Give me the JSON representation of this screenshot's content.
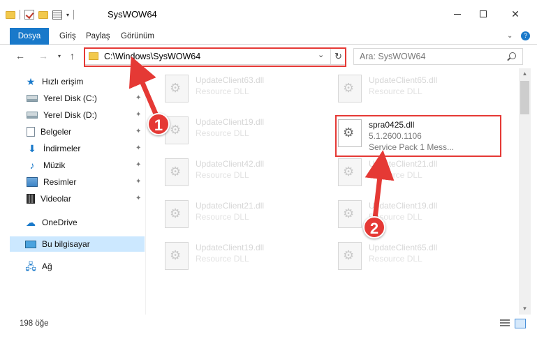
{
  "window": {
    "title": "SysWOW64",
    "minimize_glyph": "",
    "maximize_glyph": "",
    "close_glyph": "✕"
  },
  "ribbon": {
    "tabs": [
      {
        "label": "Dosya"
      },
      {
        "label": "Giriş"
      },
      {
        "label": "Paylaş"
      },
      {
        "label": "Görünüm"
      }
    ],
    "expand_glyph": "⌄",
    "help_glyph": "?"
  },
  "navigation": {
    "back_glyph": "←",
    "forward_glyph": "→",
    "recent_glyph": "▾",
    "up_glyph": "↑",
    "address": "C:\\Windows\\SysWOW64",
    "address_dropdown_glyph": "⌄",
    "refresh_glyph": "↻",
    "search_placeholder": "Ara: SysWOW64"
  },
  "sidebar": {
    "items": [
      {
        "label": "Hızlı erişim",
        "icon": "star-icon"
      },
      {
        "label": "Yerel Disk (C:)",
        "icon": "drive-icon",
        "pinned": true
      },
      {
        "label": "Yerel Disk (D:)",
        "icon": "drive-icon",
        "pinned": true
      },
      {
        "label": "Belgeler",
        "icon": "documents-icon",
        "pinned": true
      },
      {
        "label": "İndirmeler",
        "icon": "download-icon",
        "pinned": true
      },
      {
        "label": "Müzik",
        "icon": "music-icon",
        "pinned": true
      },
      {
        "label": "Resimler",
        "icon": "pictures-icon",
        "pinned": true
      },
      {
        "label": "Videolar",
        "icon": "videos-icon",
        "pinned": true
      },
      {
        "label": "OneDrive",
        "icon": "cloud-icon"
      },
      {
        "label": "Bu bilgisayar",
        "icon": "computer-icon",
        "selected": true
      },
      {
        "label": "Ağ",
        "icon": "network-icon"
      }
    ],
    "pin_glyph": "📌"
  },
  "files": {
    "left_column": [
      {
        "name": "UpdateClient63.dll",
        "type": "Resource DLL"
      },
      {
        "name": "UpdateClient19.dll",
        "type": "Resource DLL"
      },
      {
        "name": "UpdateClient42.dll",
        "type": "Resource DLL"
      },
      {
        "name": "UpdateClient21.dll",
        "type": "Resource DLL"
      },
      {
        "name": "UpdateClient19.dll",
        "type": "Resource DLL"
      }
    ],
    "right_column": [
      {
        "name": "UpdateClient65.dll",
        "type": "Resource DLL"
      },
      {
        "name": "UpdateClient21.dll",
        "type": "Resource DLL"
      },
      {
        "name": "UpdateClient19.dll",
        "type": "Resource DLL"
      },
      {
        "name": "UpdateClient65.dll",
        "type": "Resource DLL"
      }
    ],
    "target": {
      "name": "spra0425.dll",
      "version": "5.1.2600.1106",
      "description": "Service Pack 1 Mess..."
    }
  },
  "scrollbar": {
    "up_glyph": "▲",
    "down_glyph": "▼"
  },
  "status": {
    "count": "198 öğe"
  },
  "annotations": {
    "step1": "1",
    "step2": "2",
    "highlight_color": "#e53935"
  }
}
